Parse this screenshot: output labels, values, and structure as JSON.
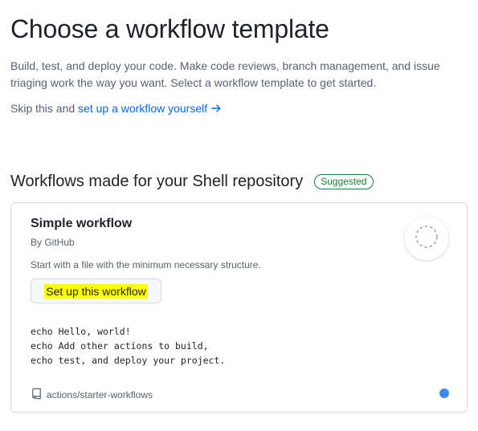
{
  "header": {
    "title": "Choose a workflow template",
    "intro": "Build, test, and deploy your code. Make code reviews, branch management, and issue triaging work the way you want. Select a workflow template to get started.",
    "skip_prefix": "Skip this and ",
    "skip_link": "set up a workflow yourself",
    "skip_icon": "arrow-right-icon"
  },
  "section": {
    "title": "Workflows made for your Shell repository",
    "badge": "Suggested",
    "badge_color": "#1a7f37"
  },
  "workflow_card": {
    "title": "Simple workflow",
    "author": "By GitHub",
    "description": "Start with a file with the minimum necessary structure.",
    "button_label": "Set up this workflow",
    "button_highlight": "#ffff00",
    "logo_icon": "dashed-circle-icon",
    "code_lines": [
      "echo Hello, world!",
      "echo Add other actions to build,",
      "echo test, and deploy your project."
    ],
    "repo_icon": "repo-icon",
    "repo": "actions/starter-workflows",
    "language_color": "#3a8ee6"
  },
  "colors": {
    "link": "#0969da",
    "muted_text": "#59636e",
    "border": "#d1d9e0"
  }
}
